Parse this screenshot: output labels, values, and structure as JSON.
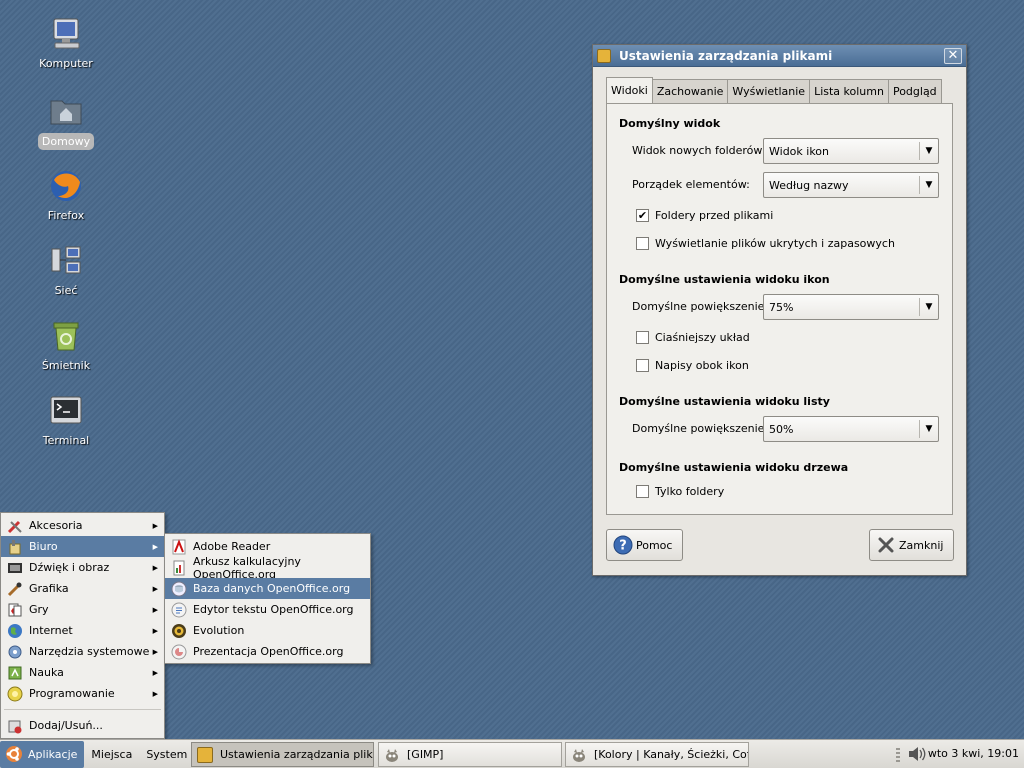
{
  "desktop": {
    "icons": [
      {
        "label": "Komputer"
      },
      {
        "label": "Domowy"
      },
      {
        "label": "Firefox"
      },
      {
        "label": "Sieć"
      },
      {
        "label": "Śmietnik"
      },
      {
        "label": "Terminal"
      }
    ]
  },
  "dialog": {
    "title": "Ustawienia zarządzania plikami",
    "close_glyph": "✕",
    "tabs": [
      "Widoki",
      "Zachowanie",
      "Wyświetlanie",
      "Lista kolumn",
      "Podgląd"
    ],
    "active_tab": "Widoki",
    "sections": {
      "default_view": "Domyślny widok",
      "icon_view": "Domyślne ustawienia widoku ikon",
      "list_view": "Domyślne ustawienia widoku listy",
      "tree_view": "Domyślne ustawienia widoku drzewa"
    },
    "new_folder_view": {
      "label": "Widok nowych folderów:",
      "value": "Widok ikon"
    },
    "sort_order": {
      "label": "Porządek elementów:",
      "value": "Według nazwy"
    },
    "folders_first": {
      "label": "Foldery przed plikami",
      "checked": true
    },
    "show_hidden": {
      "label": "Wyświetlanie plików ukrytych i zapasowych",
      "checked": false
    },
    "icon_zoom": {
      "label": "Domyślne powiększenie:",
      "value": "75%"
    },
    "compact_layout": {
      "label": "Ciaśniejszy układ",
      "checked": false
    },
    "text_beside_icons": {
      "label": "Napisy obok ikon",
      "checked": false
    },
    "list_zoom": {
      "label": "Domyślne powiększenie:",
      "value": "50%"
    },
    "only_folders": {
      "label": "Tylko foldery",
      "checked": false
    },
    "check_glyph": "✔",
    "combo_arrow": "▼",
    "help_label": "Pomoc",
    "close_label": "Zamknij"
  },
  "apps_menu": {
    "items": [
      {
        "label": "Akcesoria"
      },
      {
        "label": "Biuro"
      },
      {
        "label": "Dźwięk i obraz"
      },
      {
        "label": "Grafika"
      },
      {
        "label": "Gry"
      },
      {
        "label": "Internet"
      },
      {
        "label": "Narzędzia systemowe"
      },
      {
        "label": "Nauka"
      },
      {
        "label": "Programowanie"
      }
    ],
    "add_remove": "Dodaj/Usuń...",
    "arrow": "▶"
  },
  "office_menu": {
    "items": [
      {
        "label": "Adobe Reader"
      },
      {
        "label": "Arkusz kalkulacyjny OpenOffice.org"
      },
      {
        "label": "Baza danych OpenOffice.org"
      },
      {
        "label": "Edytor tekstu OpenOffice.org"
      },
      {
        "label": "Evolution"
      },
      {
        "label": "Prezentacja OpenOffice.org"
      }
    ]
  },
  "taskbar": {
    "applications": "Aplikacje",
    "places": "Miejsca",
    "system": "System",
    "tasks": [
      {
        "label": "Ustawienia zarządzania plikami"
      },
      {
        "label": "[GIMP]"
      },
      {
        "label": "[Kolory | Kanały, Ścieżki, Cof..."
      }
    ],
    "clock": "wto  3 kwi, 19:01"
  },
  "colors": {
    "desktop_bg": "#4a6a8c",
    "highlight": "#5a7ca3",
    "titlebar": "#4a6d95"
  }
}
